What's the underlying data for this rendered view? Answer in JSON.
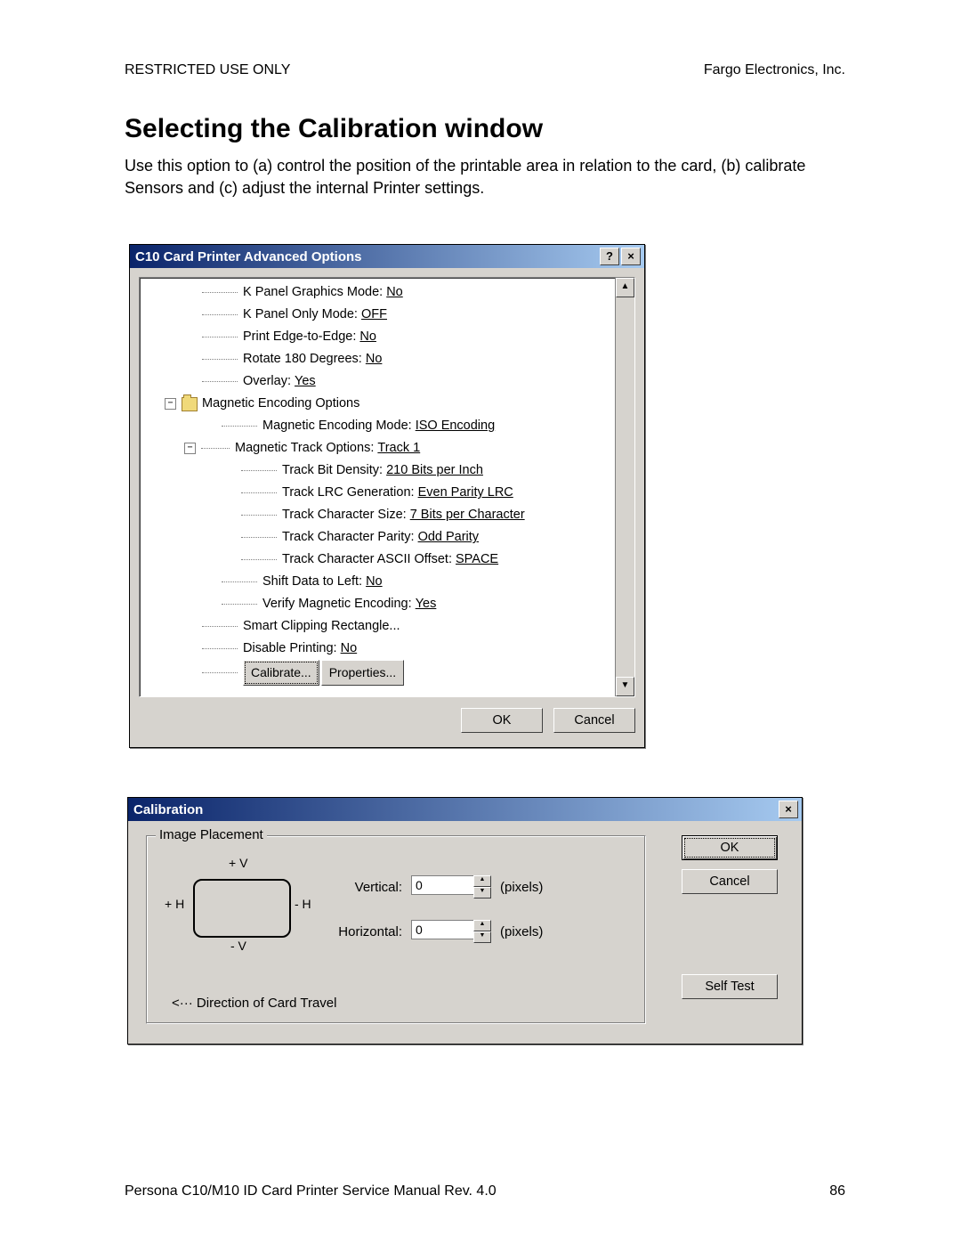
{
  "header": {
    "left": "RESTRICTED USE ONLY",
    "right": "Fargo Electronics, Inc."
  },
  "title": "Selecting the Calibration window",
  "intro": "Use this option to (a) control the position of the printable area in relation to the card, (b) calibrate Sensors and (c) adjust the internal Printer settings.",
  "dlg1": {
    "title": "C10 Card Printer Advanced Options",
    "help_glyph": "?",
    "close_glyph": "×",
    "tree": {
      "r1": {
        "label": "K Panel Graphics Mode:",
        "value": "No"
      },
      "r2": {
        "label": "K Panel Only Mode:",
        "value": "OFF"
      },
      "r3": {
        "label": "Print Edge-to-Edge:",
        "value": "No"
      },
      "r4": {
        "label": "Rotate 180 Degrees:",
        "value": "No"
      },
      "r5": {
        "label": "Overlay:",
        "value": "Yes"
      },
      "r6": {
        "label": "Magnetic Encoding Options"
      },
      "r7": {
        "label": "Magnetic Encoding Mode:",
        "value": "ISO Encoding"
      },
      "r8": {
        "label": "Magnetic Track Options:",
        "value": "Track 1"
      },
      "r9": {
        "label": "Track Bit Density:",
        "value": "210 Bits per Inch"
      },
      "r10": {
        "label": "Track LRC Generation:",
        "value": "Even Parity LRC"
      },
      "r11": {
        "label": "Track Character Size:",
        "value": "7 Bits per Character"
      },
      "r12": {
        "label": "Track Character Parity:",
        "value": "Odd Parity"
      },
      "r13": {
        "label": "Track Character ASCII Offset:",
        "value": "SPACE"
      },
      "r14": {
        "label": "Shift Data to Left:",
        "value": "No"
      },
      "r15": {
        "label": "Verify Magnetic Encoding:",
        "value": "Yes"
      },
      "r16": {
        "label": "Smart Clipping Rectangle..."
      },
      "r17": {
        "label": "Disable Printing:",
        "value": "No"
      },
      "r18": {
        "btn1": "Calibrate...",
        "btn2": "Properties..."
      }
    },
    "ok": "OK",
    "cancel": "Cancel",
    "scroll_up": "▲",
    "scroll_dn": "▼"
  },
  "dlg2": {
    "title": "Calibration",
    "close_glyph": "×",
    "group": "Image Placement",
    "plus_v": "+ V",
    "plus_h": "+ H",
    "minus_h": "- H",
    "minus_v": "- V",
    "vertical_label": "Vertical:",
    "horizontal_label": "Horizontal:",
    "vertical_value": "0",
    "horizontal_value": "0",
    "units": "(pixels)",
    "direction": "<··· Direction of Card Travel",
    "ok": "OK",
    "cancel": "Cancel",
    "selftest": "Self Test",
    "spin_up": "▲",
    "spin_dn": "▼"
  },
  "footer": {
    "left": "Persona C10/M10 ID Card Printer Service Manual Rev. 4.0",
    "right": "86"
  }
}
